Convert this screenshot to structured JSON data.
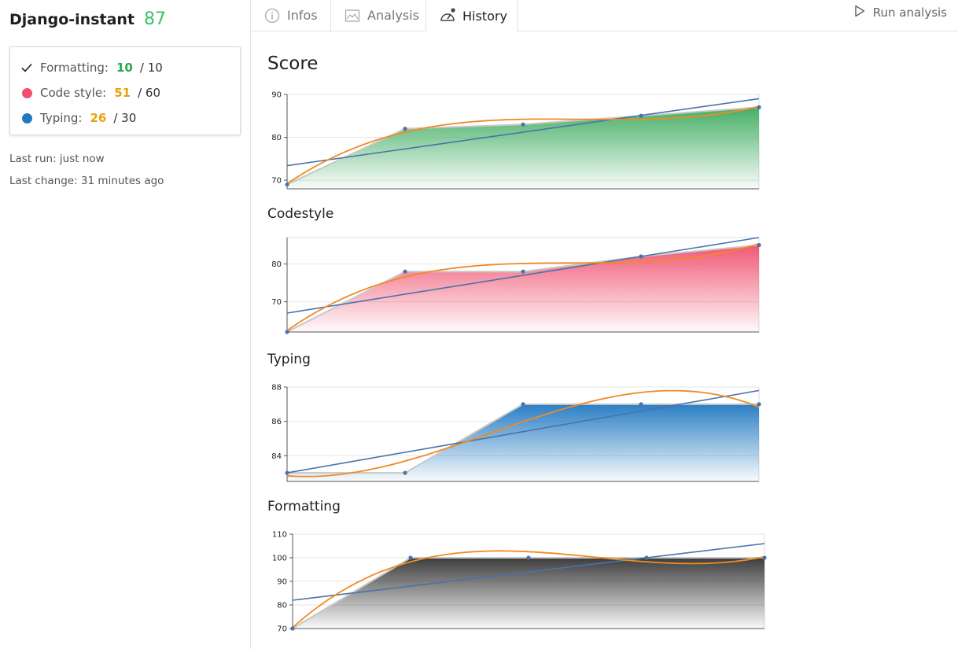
{
  "project": {
    "name": "Django-instant",
    "score": "87"
  },
  "summary": {
    "formatting": {
      "label": "Formatting:",
      "value": "10",
      "max": "/ 10",
      "color": "#2aa54a"
    },
    "codestyle": {
      "label": "Code style:",
      "value": "51",
      "max": "/ 60",
      "color": "#e8a20c",
      "dot": "#f0506e"
    },
    "typing": {
      "label": "Typing:",
      "value": "26",
      "max": "/ 30",
      "color": "#e8a20c",
      "dot": "#1f78c1"
    }
  },
  "meta": {
    "last_run": "Last run: just now",
    "last_change": "Last change: 31 minutes ago"
  },
  "tabs": [
    {
      "label": "Infos",
      "icon": "info-icon"
    },
    {
      "label": "Analysis",
      "icon": "image-icon"
    },
    {
      "label": "History",
      "icon": "gauge-icon",
      "active": true
    }
  ],
  "run_label": "Run analysis",
  "main": {
    "title": "Score"
  },
  "chart_data": [
    {
      "type": "area",
      "title": "Score",
      "x": [
        1,
        2,
        3,
        4,
        5
      ],
      "values": [
        69,
        82,
        83,
        85,
        87
      ],
      "ylim": [
        68,
        90
      ],
      "yticks": [
        70,
        80,
        90
      ],
      "fill": "#3aaa5c",
      "trend_line": true,
      "smooth_fit": true
    },
    {
      "type": "area",
      "title": "Codestyle",
      "x": [
        1,
        2,
        3,
        4,
        5
      ],
      "values": [
        62,
        78,
        78,
        82,
        85
      ],
      "ylim": [
        62,
        87
      ],
      "yticks": [
        70,
        80
      ],
      "fill": "#f0506e",
      "trend_line": true,
      "smooth_fit": true
    },
    {
      "type": "area",
      "title": "Typing",
      "x": [
        1,
        2,
        3,
        4,
        5
      ],
      "values": [
        83,
        83,
        87,
        87,
        87
      ],
      "ylim": [
        82.5,
        88
      ],
      "yticks": [
        84,
        86,
        88
      ],
      "fill": "#1f78c1",
      "trend_line": true,
      "smooth_fit": true
    },
    {
      "type": "area",
      "title": "Formatting",
      "x": [
        1,
        2,
        3,
        4,
        5
      ],
      "values": [
        70,
        100,
        100,
        100,
        100
      ],
      "ylim": [
        70,
        110
      ],
      "yticks": [
        70,
        80,
        90,
        100,
        110
      ],
      "fill": "#333333",
      "trend_line": true,
      "smooth_fit": true
    }
  ]
}
